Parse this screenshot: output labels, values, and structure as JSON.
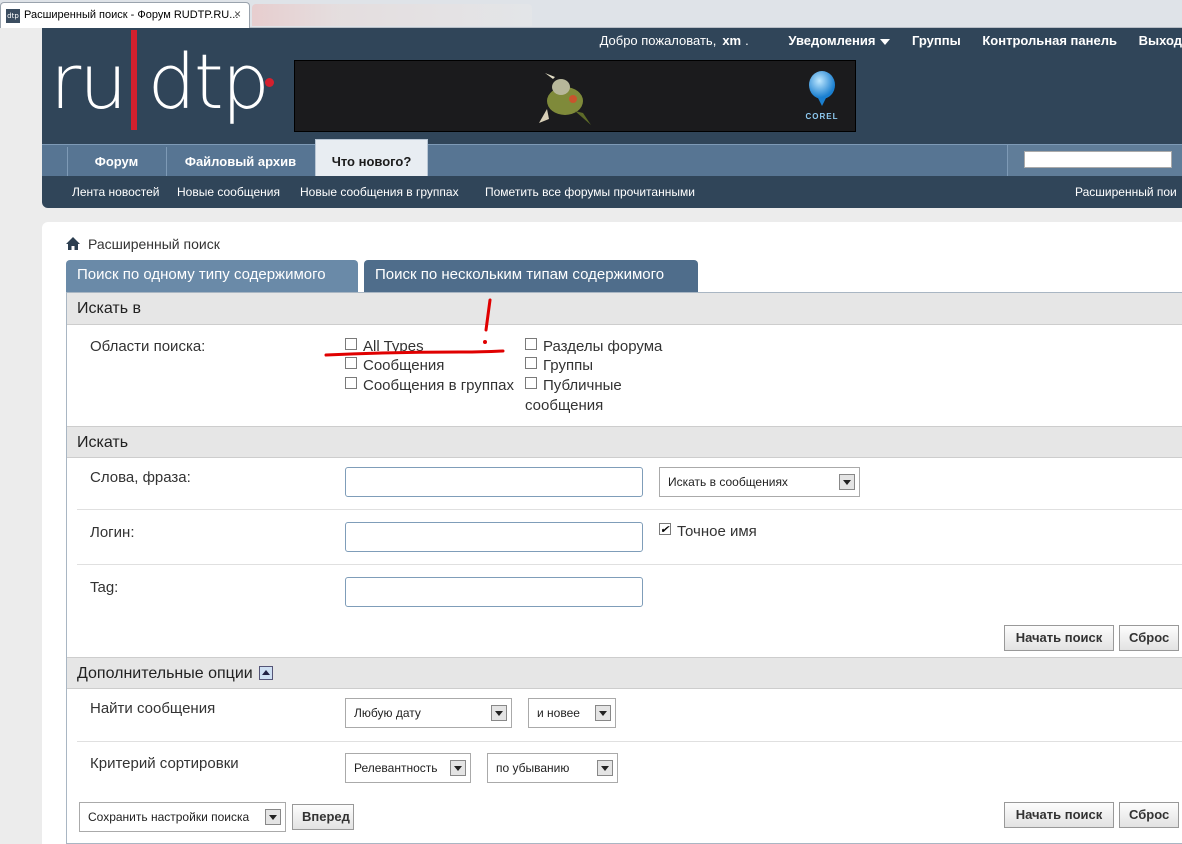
{
  "browser": {
    "tab_title": "Расширенный поиск - Форум RUDTP.RU...",
    "favicon": "dtp",
    "close": "×"
  },
  "header": {
    "logo_text": "ru dtp",
    "welcome": "Добро пожаловать,",
    "username": "xm",
    "dot": ".",
    "notifications": "Уведомления",
    "groups": "Группы",
    "control_panel": "Контрольная панель",
    "logout": "Выход",
    "banner_brand": "COREL"
  },
  "nav": {
    "tabs": [
      "Форум",
      "Файловый архив",
      "Что нового?"
    ],
    "active_tab": 2,
    "search_placeholder": "",
    "subnav": [
      "Лента новостей",
      "Новые сообщения",
      "Новые сообщения в группах",
      "Пометить все форумы прочитанными",
      "Расширенный пои"
    ]
  },
  "page": {
    "breadcrumb": "Расширенный поиск",
    "tabs": [
      "Поиск по одному типу содержимого",
      "Поиск по нескольким типам содержимого"
    ],
    "active_tab": 1
  },
  "section_search_in": {
    "title": "Искать в",
    "label": "Области поиска:",
    "checkboxes_left": [
      {
        "label": "All Types",
        "checked": false
      },
      {
        "label": "Сообщения",
        "checked": false
      },
      {
        "label": "Сообщения в группах",
        "checked": false
      }
    ],
    "checkboxes_right": [
      {
        "label": "Разделы форума",
        "checked": false
      },
      {
        "label": "Группы",
        "checked": false
      },
      {
        "label": "Публичные",
        "checked": false
      }
    ],
    "wrap_text": "сообщения",
    "annotation_mark": "!",
    "annotation_color": "#e00000"
  },
  "section_search": {
    "title": "Искать",
    "words_label": "Слова, фраза:",
    "words_value": "",
    "words_scope": "Искать в сообщениях",
    "login_label": "Логин:",
    "login_value": "",
    "exact_name": "Точное имя",
    "exact_checked": true,
    "tag_label": "Tag:",
    "tag_value": "",
    "start_button": "Начать поиск",
    "reset_button": "Сброс"
  },
  "section_options": {
    "title": "Дополнительные опции",
    "find_label": "Найти сообщения",
    "date_select": "Любую дату",
    "date_dir": "и новее",
    "sort_label": "Критерий сортировки",
    "sort_select": "Релевантность",
    "sort_dir": "по убыванию",
    "save_select": "Сохранить настройки поиска",
    "forward_button": "Вперед",
    "start_button": "Начать поиск",
    "reset_button": "Сброс"
  },
  "colors": {
    "header_bg": "#304559",
    "nav_bg": "#577593",
    "brand_red": "#d4202e",
    "tab_active": "#4f6d8b"
  }
}
